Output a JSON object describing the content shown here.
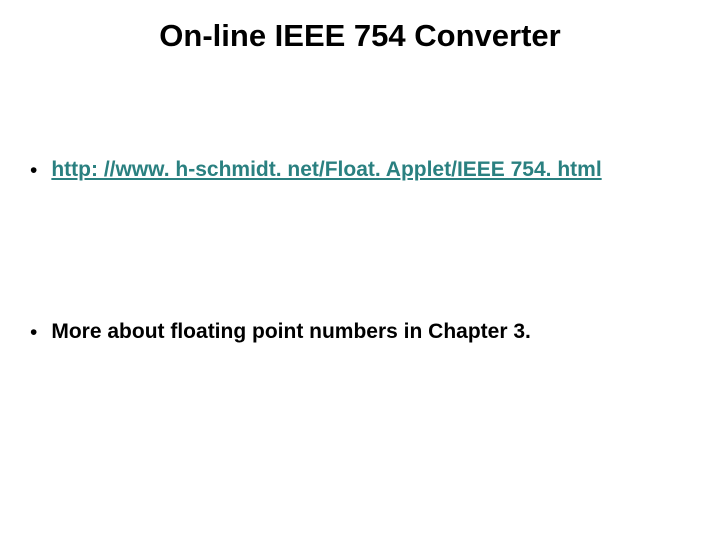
{
  "title": "On-line IEEE 754 Converter",
  "bullets": {
    "link": "http: //www. h-schmidt. net/Float. Applet/IEEE 754. html",
    "note": "More about floating point numbers in Chapter 3."
  }
}
